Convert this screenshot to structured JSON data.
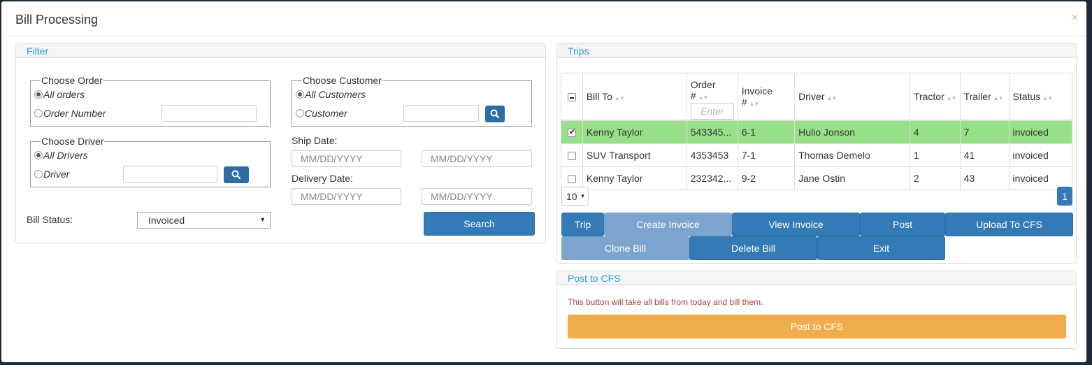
{
  "modal": {
    "title": "Bill Processing",
    "close": "×"
  },
  "filter": {
    "heading": "Filter",
    "choose_order": {
      "legend": "Choose Order",
      "all_label": "All orders",
      "specific_label": "Order Number",
      "value": ""
    },
    "choose_customer": {
      "legend": "Choose Customer",
      "all_label": "All Customers",
      "specific_label": "Customer",
      "value": ""
    },
    "choose_driver": {
      "legend": "Choose Driver",
      "all_label": "All Drivers",
      "specific_label": "Driver",
      "value": ""
    },
    "ship_date": {
      "label": "Ship Date:",
      "from_placeholder": "MM/DD/YYYY",
      "to_placeholder": "MM/DD/YYYY"
    },
    "delivery_date": {
      "label": "Delivery Date:",
      "from_placeholder": "MM/DD/YYYY",
      "to_placeholder": "MM/DD/YYYY"
    },
    "bill_status": {
      "label": "Bill Status:",
      "selected": "Invoiced"
    },
    "search_label": "Search"
  },
  "trips": {
    "heading": "Trips",
    "columns": [
      "Bill To",
      "Order #",
      "Invoice #",
      "Driver",
      "Tractor",
      "Trailer",
      "Status"
    ],
    "order_filter_placeholder": "Enter",
    "rows": [
      {
        "checked": true,
        "bill_to": "Kenny Taylor",
        "order": "543345...",
        "invoice": "6-1",
        "driver": "Hulio Jonson",
        "tractor": "4",
        "trailer": "7",
        "status": "invoiced"
      },
      {
        "checked": false,
        "bill_to": "SUV Transport",
        "order": "4353453",
        "invoice": "7-1",
        "driver": "Thomas Demelo",
        "tractor": "1",
        "trailer": "41",
        "status": "invoiced"
      },
      {
        "checked": false,
        "bill_to": "Kenny Taylor",
        "order": "232342...",
        "invoice": "9-2",
        "driver": "Jane Ostin",
        "tractor": "2",
        "trailer": "43",
        "status": "invoiced"
      }
    ],
    "page_size": "10",
    "current_page": "1",
    "buttons": {
      "trip": "Trip",
      "create_invoice": "Create Invoice",
      "view_invoice": "View Invoice",
      "post": "Post",
      "upload_cfs": "Upload To CFS",
      "clone_bill": "Clone Bill",
      "delete_bill": "Delete Bill",
      "exit": "Exit"
    }
  },
  "post_cfs": {
    "heading": "Post to CFS",
    "note": "This button will take all bills from today and bill them.",
    "button": "Post to CFS"
  },
  "colors": {
    "primary": "#337ab7",
    "selected_row": "#98df8a",
    "warning": "#f0ad4e",
    "heading_text": "#2a9fd6"
  }
}
